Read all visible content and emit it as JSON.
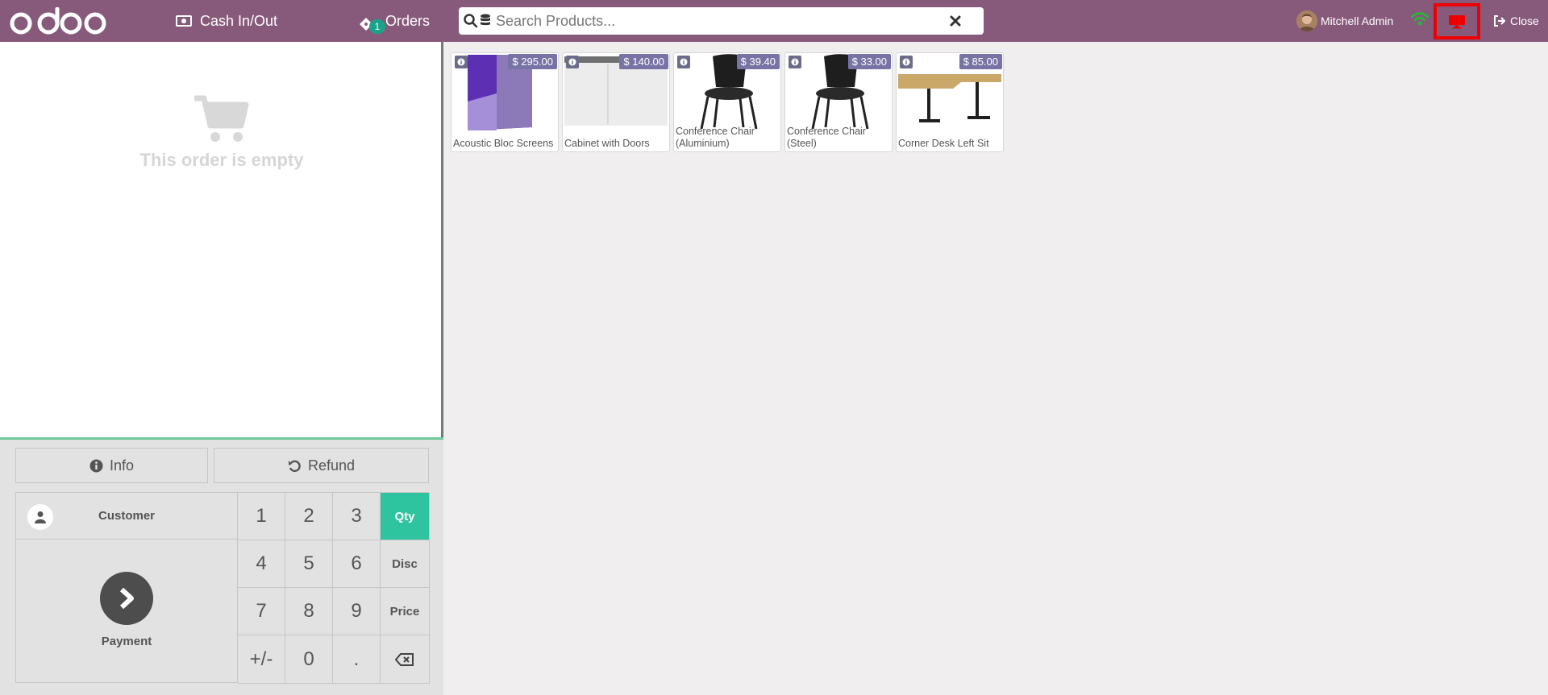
{
  "header": {
    "logo_text": "odoo",
    "cash_label": "Cash In/Out",
    "orders_label": "Orders",
    "orders_badge": "1",
    "search_placeholder": "Search Products...",
    "user_name": "Mitchell Admin",
    "close_label": "Close"
  },
  "order": {
    "empty_text": "This order is empty"
  },
  "controls": {
    "info_label": "Info",
    "refund_label": "Refund",
    "customer_label": "Customer",
    "payment_label": "Payment"
  },
  "numpad": {
    "keys": [
      "1",
      "2",
      "3",
      "Qty",
      "4",
      "5",
      "6",
      "Disc",
      "7",
      "8",
      "9",
      "Price",
      "+/-",
      "0",
      ".",
      "⌫"
    ],
    "active_mode": "Qty"
  },
  "products": [
    {
      "name": "Acoustic Bloc Screens",
      "price": "$ 295.00"
    },
    {
      "name": "Cabinet with Doors",
      "price": "$ 140.00"
    },
    {
      "name": "Conference Chair (Aluminium)",
      "price": "$ 39.40"
    },
    {
      "name": "Conference Chair (Steel)",
      "price": "$ 33.00"
    },
    {
      "name": "Corner Desk Left Sit",
      "price": "$ 85.00"
    }
  ],
  "colors": {
    "header": "#875a7b",
    "badge": "#1aa38a",
    "active_key": "#2ec4a0",
    "price_tag": "#7873a5",
    "highlight_border": "#ee0000"
  }
}
